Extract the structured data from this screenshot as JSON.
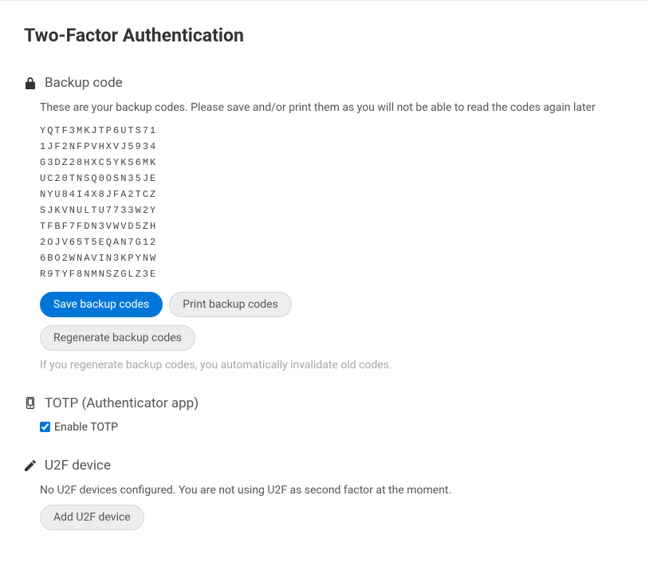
{
  "page": {
    "title": "Two-Factor Authentication"
  },
  "backup": {
    "heading": "Backup code",
    "description": "These are your backup codes. Please save and/or print them as you will not be able to read the codes again later",
    "codes": [
      "YQTF3MKJTP6UTS71",
      "1JF2NFPVHXVJ5934",
      "G3DZ28HXC5YKS6MK",
      "UC20TNSQ0OSN35JE",
      "NYU84I4X8JFA2TCZ",
      "SJKVNULTU7733W2Y",
      "TFBF7FDN3VWVD5ZH",
      "2OJV65T5EQAN7G12",
      "6BO2WNAVIN3KPYNW",
      "R9TYF8NMNSZGLZ3E"
    ],
    "save_label": "Save backup codes",
    "print_label": "Print backup codes",
    "regenerate_label": "Regenerate backup codes",
    "regenerate_note": "If you regenerate backup codes, you automatically invalidate old codes."
  },
  "totp": {
    "heading": "TOTP (Authenticator app)",
    "enable_label": "Enable TOTP",
    "enabled": true
  },
  "u2f": {
    "heading": "U2F device",
    "status_text": "No U2F devices configured. You are not using U2F as second factor at the moment.",
    "add_label": "Add U2F device"
  }
}
